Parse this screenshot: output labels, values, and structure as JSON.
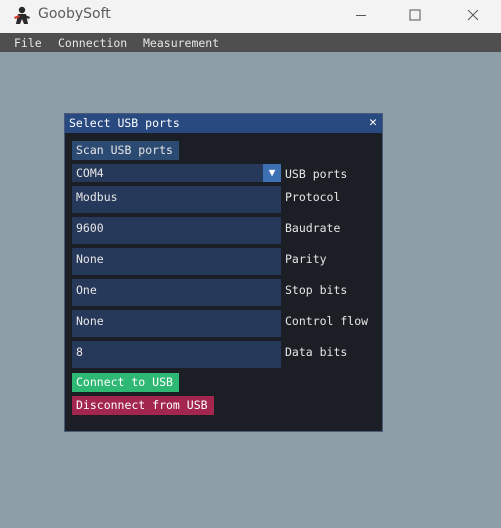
{
  "window": {
    "title": "GoobySoft",
    "minimize_icon": "minimize-icon",
    "maximize_icon": "maximize-icon",
    "close_icon": "close-icon"
  },
  "menu": {
    "items": [
      "File",
      "Connection",
      "Measurement"
    ]
  },
  "dialog": {
    "title": "Select USB ports",
    "close_glyph": "✕",
    "scan_button": "Scan USB ports",
    "usb_port": {
      "value": "COM4",
      "label": "USB ports",
      "arrow": "▼"
    },
    "fields": [
      {
        "value": "Modbus",
        "label": "Protocol"
      },
      {
        "value": "9600",
        "label": "Baudrate"
      },
      {
        "value": "None",
        "label": "Parity"
      },
      {
        "value": "One",
        "label": "Stop bits"
      },
      {
        "value": "None",
        "label": "Control flow"
      },
      {
        "value": "8",
        "label": "Data bits"
      }
    ],
    "connect_button": "Connect to USB",
    "disconnect_button": "Disconnect from USB"
  },
  "colors": {
    "workspace": "#8e9ea8",
    "dialog_bg": "#1b1e24",
    "dialog_title": "#284a80",
    "field_bg": "#27395a",
    "connect": "#2fb874",
    "disconnect": "#a3264f"
  }
}
